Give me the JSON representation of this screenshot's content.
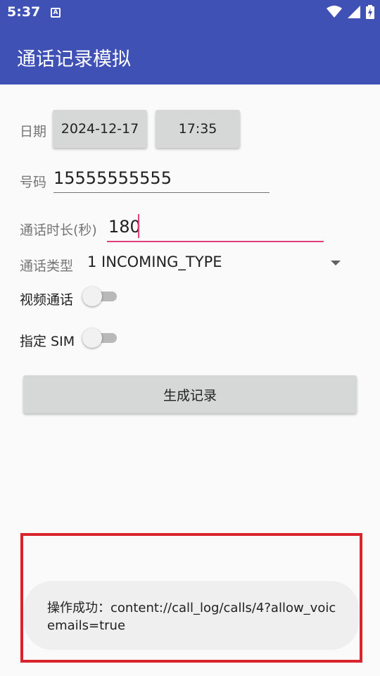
{
  "status_bar": {
    "time": "5:37",
    "notification_icon": "A"
  },
  "app_bar": {
    "title": "通话记录模拟"
  },
  "form": {
    "date_label": "日期",
    "date_value": "2024-12-17",
    "time_value": "17:35",
    "number_label": "号码",
    "number_value": "15555555555",
    "duration_label": "通话时长(秒)",
    "duration_value": "180",
    "type_label": "通话类型",
    "type_value": "1 INCOMING_TYPE",
    "video_label": "视频通话",
    "video_on": false,
    "sim_label": "指定 SIM",
    "sim_on": false,
    "generate_label": "生成记录"
  },
  "toast": {
    "message": "操作成功：content://call_log/calls/4?allow_voicemails=true"
  },
  "colors": {
    "primary": "#3f51b5",
    "accent": "#e0417d",
    "highlight": "#d9232d"
  }
}
